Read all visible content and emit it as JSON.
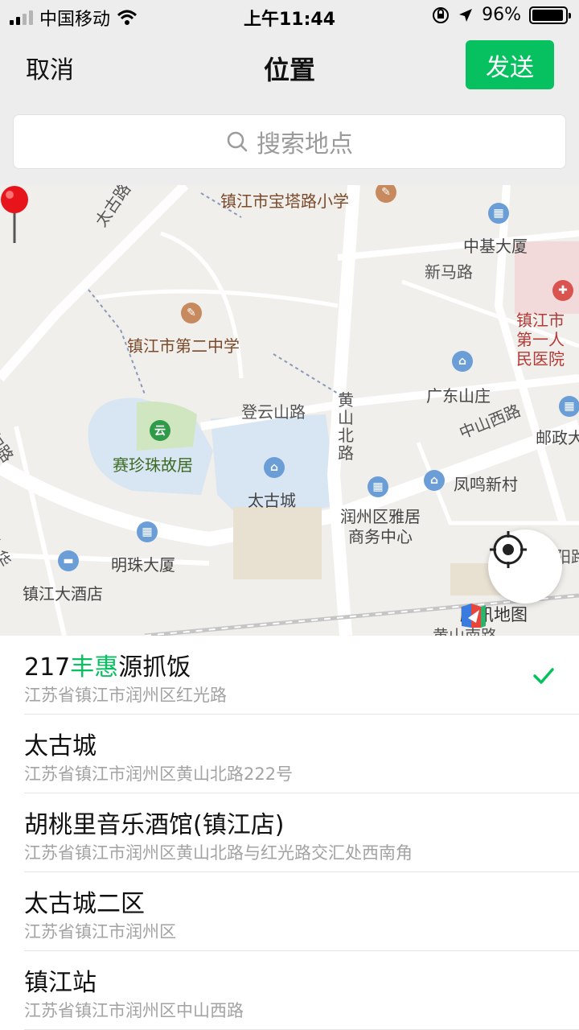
{
  "status_bar": {
    "carrier": "中国移动",
    "time": "上午11:44",
    "battery": "96%",
    "battery_level": 0.96
  },
  "nav": {
    "cancel_label": "取消",
    "title": "位置",
    "send_label": "发送"
  },
  "search": {
    "placeholder": "搜索地点"
  },
  "map": {
    "labels": {
      "school1": "镇江市宝塔路小学",
      "road_taigu": "太古路",
      "zhongji": "中基大厦",
      "xinma": "新马路",
      "hospital": "镇江市第一人民医院",
      "school2": "镇江市第二中学",
      "dengyun": "登云山路",
      "huangshan_n": "黄山北路",
      "guangdong": "广东山庄",
      "zhongshan_w": "中山西路",
      "post": "邮政大",
      "saizhenzhu": "赛珍珠故居",
      "taigucheng": "太古城",
      "fengming": "凤鸣新村",
      "yaju": "润州区雅居商务中心",
      "mingzhu": "明珠大厦",
      "hotel": "镇江大酒店",
      "huangshan_s": "黄山南路",
      "road_left": "甸路",
      "road_left2": "九华",
      "road_right": "阳路"
    },
    "logo_text": "腾讯地图"
  },
  "results": [
    {
      "name_prefix": "217",
      "name_highlight": "丰惠",
      "name_suffix": "源抓饭",
      "address": "江苏省镇江市润州区红光路",
      "selected": true
    },
    {
      "name_prefix": "太古城",
      "name_highlight": "",
      "name_suffix": "",
      "address": "江苏省镇江市润州区黄山北路222号",
      "selected": false
    },
    {
      "name_prefix": "胡桃里音乐酒馆(镇江店)",
      "name_highlight": "",
      "name_suffix": "",
      "address": "江苏省镇江市润州区黄山北路与红光路交汇处西南角",
      "selected": false
    },
    {
      "name_prefix": "太古城二区",
      "name_highlight": "",
      "name_suffix": "",
      "address": "江苏省镇江市润州区",
      "selected": false
    },
    {
      "name_prefix": "镇江站",
      "name_highlight": "",
      "name_suffix": "",
      "address": "江苏省镇江市润州区中山西路",
      "selected": false
    }
  ],
  "colors": {
    "accent": "#07c160"
  }
}
